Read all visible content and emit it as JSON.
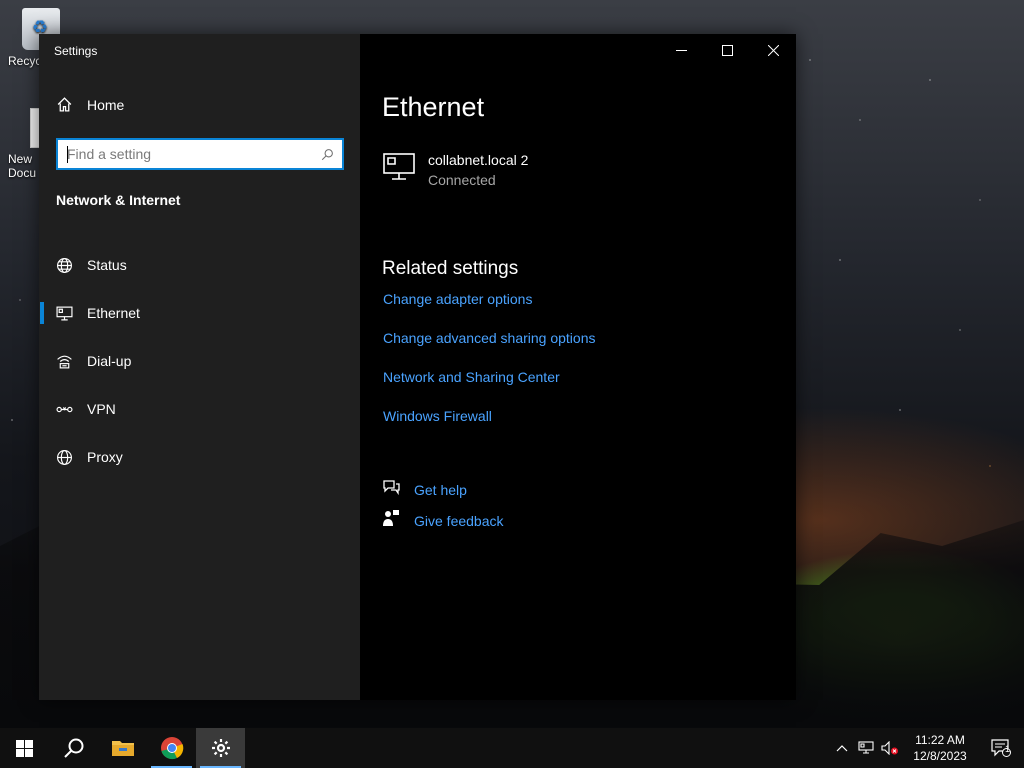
{
  "desktop": {
    "icons": [
      {
        "label": "Recyc"
      },
      {
        "label": "New Docu"
      }
    ]
  },
  "window": {
    "title": "Settings",
    "controls": {
      "minimize": "minimize",
      "maximize": "maximize",
      "close": "close"
    }
  },
  "sidebar": {
    "home_label": "Home",
    "search_placeholder": "Find a setting",
    "section_title": "Network & Internet",
    "items": [
      {
        "label": "Status",
        "icon": "globe-status-icon"
      },
      {
        "label": "Ethernet",
        "icon": "ethernet-icon",
        "active": true
      },
      {
        "label": "Dial-up",
        "icon": "dialup-icon"
      },
      {
        "label": "VPN",
        "icon": "vpn-icon"
      },
      {
        "label": "Proxy",
        "icon": "globe-icon"
      }
    ]
  },
  "main": {
    "title": "Ethernet",
    "connection": {
      "name": "collabnet.local 2",
      "status": "Connected"
    },
    "related_title": "Related settings",
    "related_links": [
      "Change adapter options",
      "Change advanced sharing options",
      "Network and Sharing Center",
      "Windows Firewall"
    ],
    "help": {
      "get_help": "Get help",
      "give_feedback": "Give feedback"
    }
  },
  "taskbar": {
    "apps": [
      "start",
      "search",
      "file-explorer",
      "chrome",
      "settings"
    ],
    "clock": {
      "time": "11:22 AM",
      "date": "12/8/2023"
    },
    "notification_count": "1"
  },
  "colors": {
    "accent": "#0a84d6",
    "link": "#4aa3ff",
    "sidebar_bg": "#1f1f1f",
    "content_bg": "#000000",
    "taskbar_bg": "#101010"
  }
}
